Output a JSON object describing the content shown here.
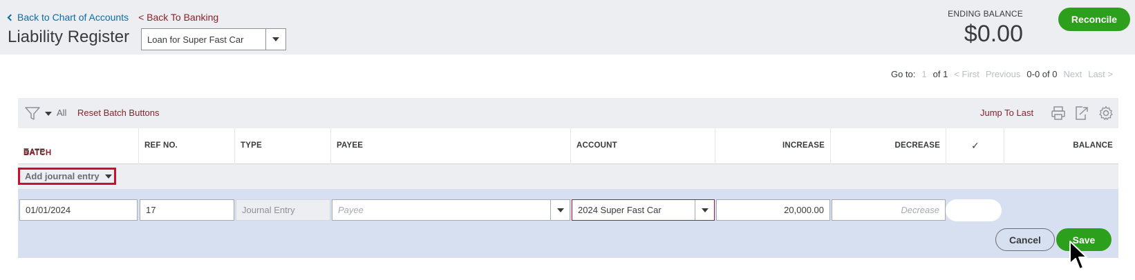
{
  "header": {
    "back_chart_label": "Back to Chart of Accounts",
    "back_banking_label": "< Back To Banking",
    "title": "Liability Register",
    "account_selected": "Loan for Super Fast Car",
    "ending_balance_label": "ENDING BALANCE",
    "ending_balance_value": "$0.00",
    "reconcile_label": "Reconcile"
  },
  "pagination": {
    "goto_label": "Go to:",
    "page_value": "1",
    "of_label": "of 1",
    "first": "< First",
    "previous": "Previous",
    "range": "0-0 of 0",
    "next": "Next",
    "last": "Last >"
  },
  "toolbar": {
    "filter_value": "All",
    "reset_batch_label": "Reset Batch Buttons",
    "jump_to_last_label": "Jump To Last",
    "icons": [
      "print-icon",
      "export-icon",
      "gear-icon"
    ]
  },
  "columns": {
    "date": "DATE",
    "batch": "BATCH",
    "ref_no": "REF NO.",
    "type": "TYPE",
    "payee": "PAYEE",
    "account": "ACCOUNT",
    "increase": "INCREASE",
    "decrease": "DECREASE",
    "check": "✓",
    "balance": "BALANCE"
  },
  "add_entry": {
    "label": "Add journal entry"
  },
  "edit_row": {
    "date": "01/01/2024",
    "ref_no": "17",
    "type": "Journal Entry",
    "payee_placeholder": "Payee",
    "account": "2024 Super Fast Car",
    "increase": "20,000.00",
    "decrease_placeholder": "Decrease",
    "cancel_label": "Cancel",
    "save_label": "Save"
  },
  "colors": {
    "accent_green": "#2ca01c",
    "link_blue": "#0d6ba8",
    "link_red": "#8d1f2a",
    "highlight_red": "#c8102e"
  }
}
